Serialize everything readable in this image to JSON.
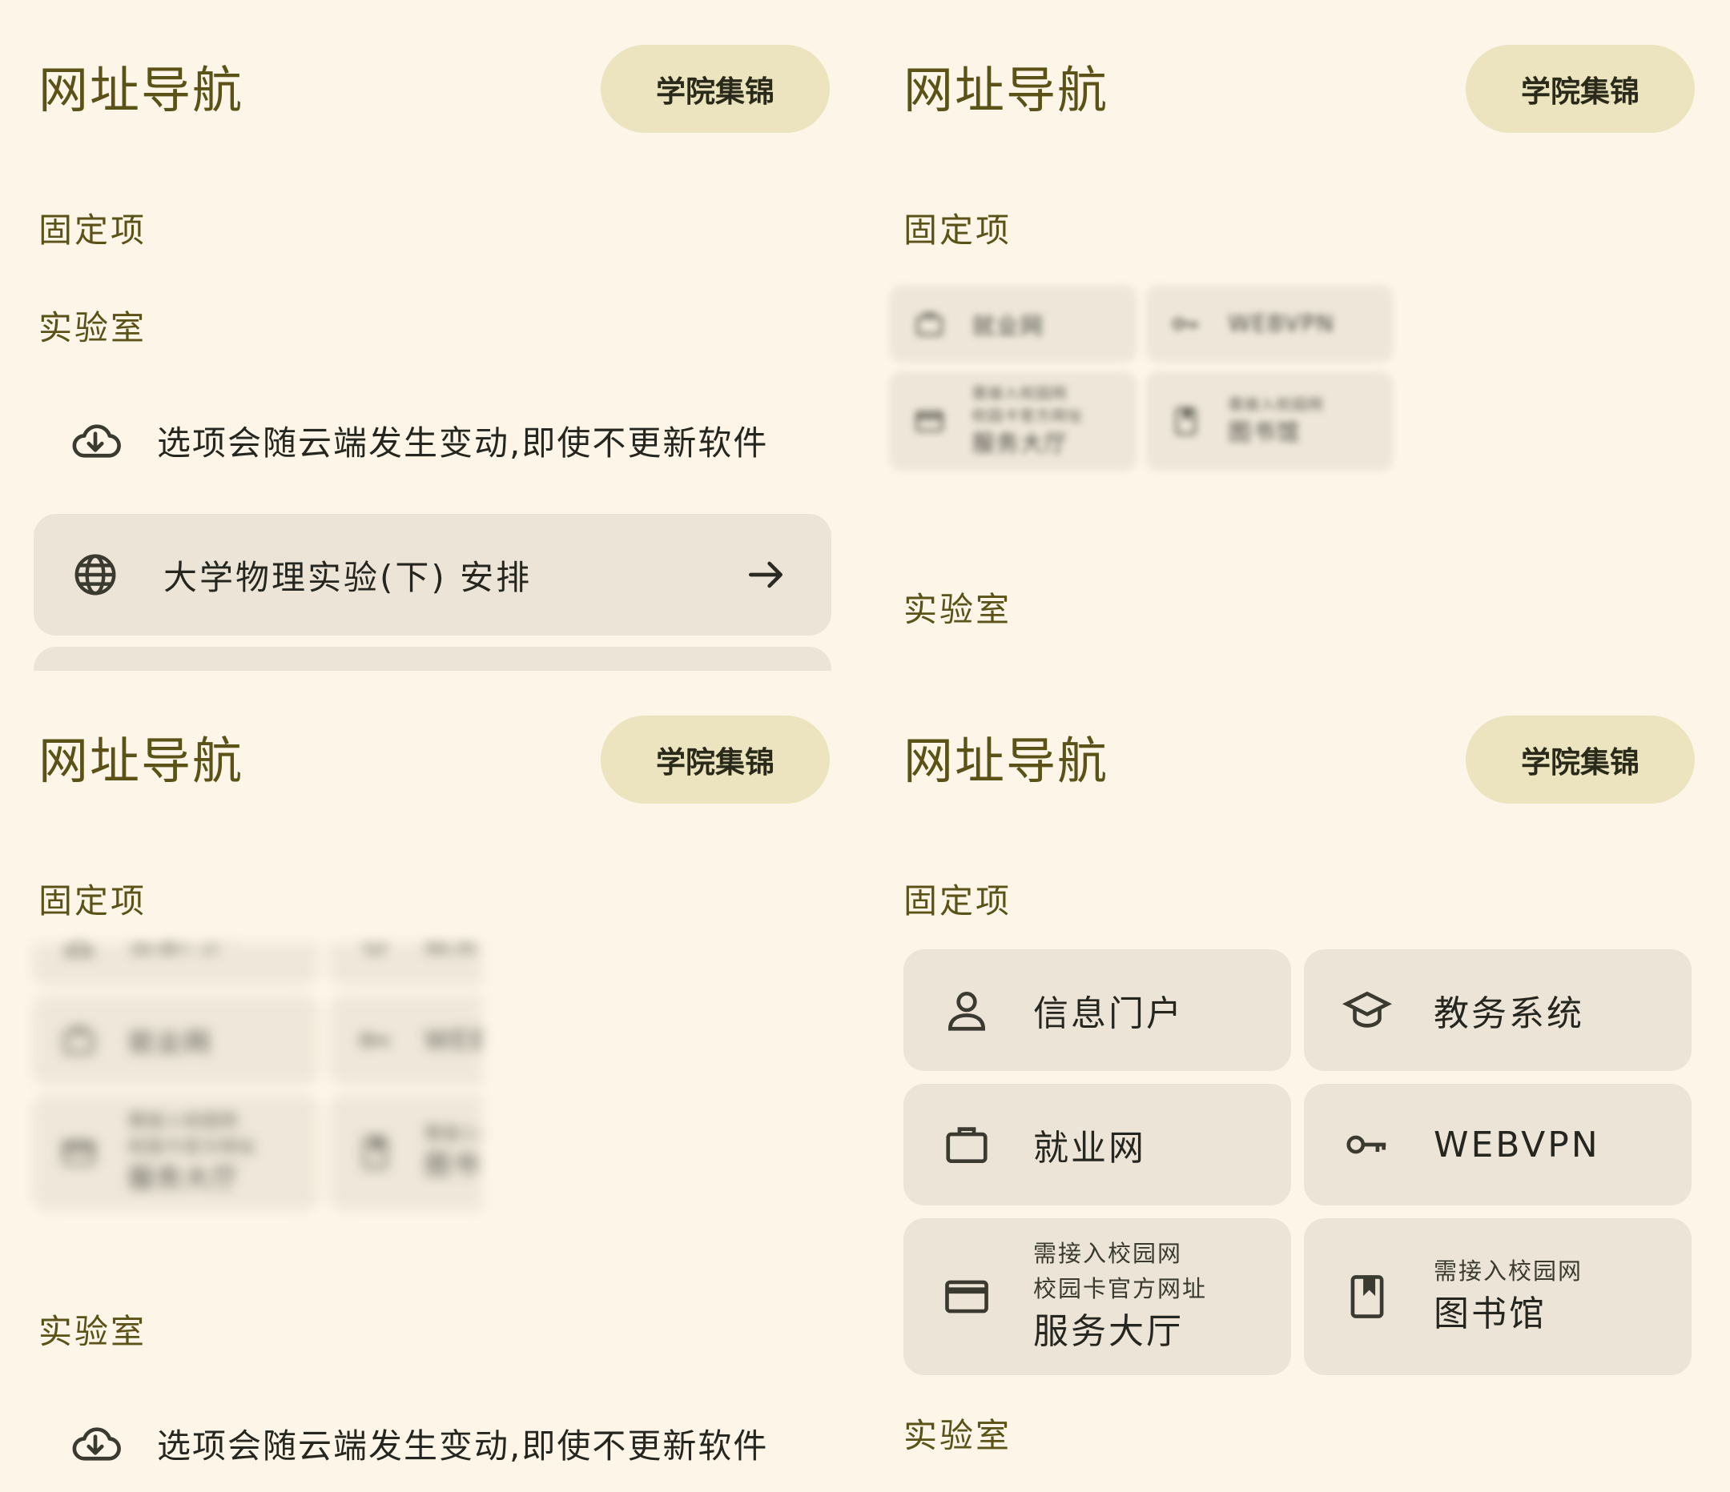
{
  "header": {
    "title": "网址导航",
    "gallery_button": "学院集锦"
  },
  "sections": {
    "pinned": "固定项",
    "lab": "实验室"
  },
  "lab_notice": "选项会随云端发生变动,即使不更新软件",
  "lab_items": [
    {
      "label": "大学物理实验(下) 安排",
      "icon": "globe-icon"
    }
  ],
  "pinned_items": [
    {
      "label": "信息门户",
      "icon": "person-icon"
    },
    {
      "label": "教务系统",
      "icon": "school-icon"
    },
    {
      "label": "就业网",
      "icon": "briefcase-icon"
    },
    {
      "label": "WEBVPN",
      "icon": "key-icon"
    },
    {
      "sub1": "需接入校园网",
      "sub2": "校园卡官方网址",
      "label": "服务大厅",
      "icon": "card-icon"
    },
    {
      "sub1": "需接入校园网",
      "label": "图书馆",
      "icon": "book-icon"
    }
  ],
  "colors": {
    "background": "#fdf6e8",
    "accent_text": "#5a5217",
    "pill": "#ebe4bf",
    "card": "#ece5d7"
  }
}
